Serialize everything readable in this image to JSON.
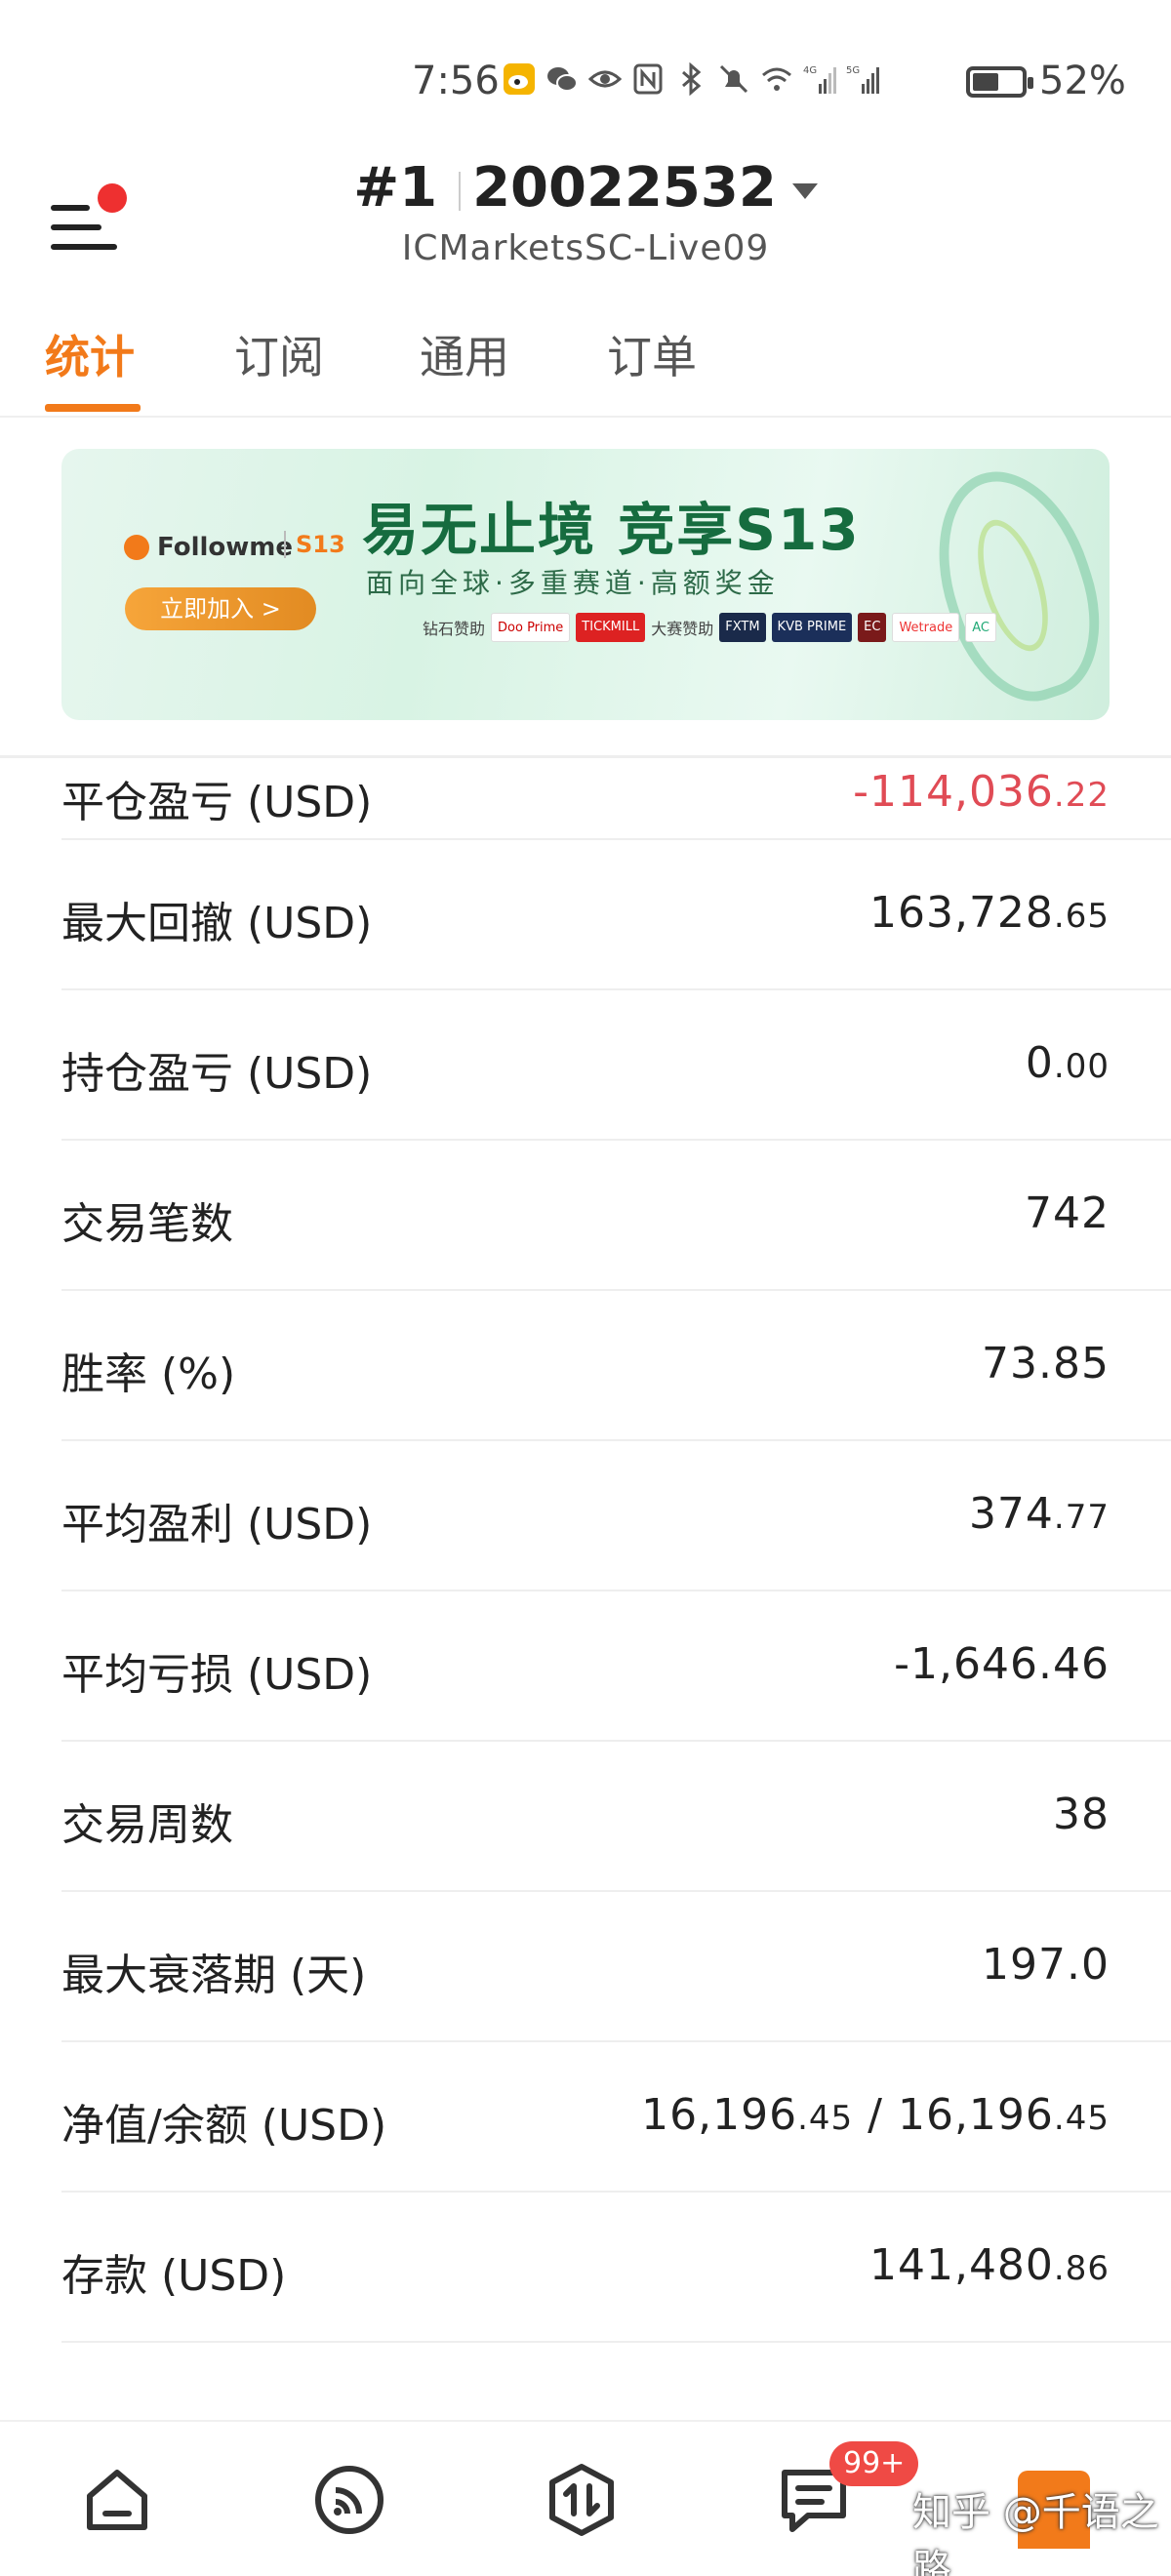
{
  "status_bar": {
    "time": "7:56",
    "battery_text": "52%",
    "battery_level": 0.52,
    "icons": [
      "weibo-icon",
      "wechat-icon",
      "eye-icon",
      "nfc-icon",
      "bluetooth-icon",
      "mute-bell-icon",
      "wifi-icon",
      "signal-4g-icon",
      "signal-5g-icon",
      "battery-icon"
    ]
  },
  "header": {
    "rank": "#1",
    "account_id": "20022532",
    "server": "ICMarketsSC-Live09",
    "menu_has_notification": true
  },
  "tabs": [
    {
      "label": "统计",
      "active": true
    },
    {
      "label": "订阅",
      "active": false
    },
    {
      "label": "通用",
      "active": false
    },
    {
      "label": "订单",
      "active": false
    }
  ],
  "banner": {
    "brand": "Followme",
    "season_tag": "S13",
    "title": "易无止境 竞享S13",
    "subtitle": "面向全球·多重赛道·高额奖金",
    "cta": "立即加入 >",
    "diamond_sponsor_label": "钻石赞助",
    "event_sponsor_label": "大赛赞助",
    "sponsors": [
      "Doo Prime",
      "TICKMILL",
      "FXTM",
      "KVB PRIME",
      "EC",
      "Wetrade",
      "AC"
    ]
  },
  "stats": [
    {
      "label": "平仓盈亏 (USD)",
      "int": "-114,036",
      "dec": ".22",
      "negative": true
    },
    {
      "label": "最大回撤 (USD)",
      "int": "163,728",
      "dec": ".65",
      "negative": false
    },
    {
      "label": "持仓盈亏 (USD)",
      "int": "0",
      "dec": ".00",
      "negative": false
    },
    {
      "label": "交易笔数",
      "int": "742",
      "dec": "",
      "negative": false
    },
    {
      "label": "胜率 (%)",
      "int": "73.85",
      "dec": "",
      "negative": false
    },
    {
      "label": "平均盈利 (USD)",
      "int": "374",
      "dec": ".77",
      "negative": false
    },
    {
      "label": "平均亏损 (USD)",
      "int": "-1,646.46",
      "dec": "",
      "negative": false
    },
    {
      "label": "交易周数",
      "int": "38",
      "dec": "",
      "negative": false
    },
    {
      "label": "最大衰落期 (天)",
      "int": "197.0",
      "dec": "",
      "negative": false
    },
    {
      "label": "净值/余额 (USD)",
      "int": "16,196",
      "dec": ".45",
      "int2": " / 16,196",
      "dec2": ".45",
      "negative": false
    },
    {
      "label": "存款 (USD)",
      "int": "141,480",
      "dec": ".86",
      "negative": false
    }
  ],
  "bottom_nav": {
    "items": [
      "home-icon",
      "feed-icon",
      "trade-icon",
      "messages-icon"
    ],
    "badge": "99+",
    "watermark": "知乎 @千语之路"
  },
  "colors": {
    "accent": "#f27a1a",
    "negative": "#e04b55",
    "badge": "#ef4a45"
  }
}
